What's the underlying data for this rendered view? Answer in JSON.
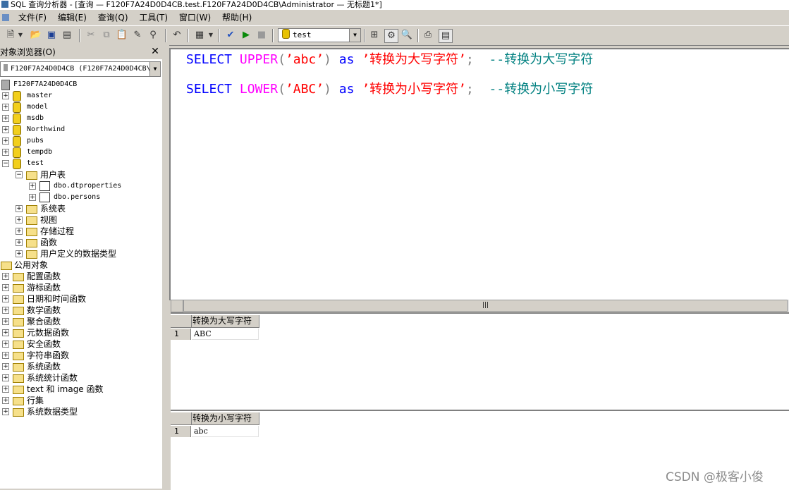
{
  "window": {
    "title": "SQL 查询分析器 - [查询 — F120F7A24D0D4CB.test.F120F7A24D0D4CB\\Administrator — 无标题1*]"
  },
  "menu": [
    "文件(F)",
    "编辑(E)",
    "查询(Q)",
    "工具(T)",
    "窗口(W)",
    "帮助(H)"
  ],
  "toolbar": {
    "icons": [
      "new-query-icon",
      "open-icon",
      "save-icon",
      "insert-template-icon",
      "cut-icon",
      "copy-icon",
      "paste-icon",
      "clear-icon",
      "find-icon",
      "undo-icon",
      "results-mode-icon",
      "parse-icon",
      "execute-icon",
      "cancel-icon",
      "object-browser-icon",
      "object-search-icon",
      "current-connection-icon",
      "results-pane-icon"
    ],
    "database": "test"
  },
  "object_browser": {
    "title": "对象浏览器(O)",
    "server_combo": "F120F7A24D0D4CB (F120F7A24D0D4CB\\",
    "root": "F120F7A24D0D4CB",
    "databases": [
      "master",
      "model",
      "msdb",
      "Northwind",
      "pubs",
      "tempdb",
      "test"
    ],
    "test_children": {
      "user_tables": "用户表",
      "tables": [
        "dbo.dtproperties",
        "dbo.persons"
      ],
      "others": [
        "系统表",
        "视图",
        "存储过程",
        "函数",
        "用户定义的数据类型"
      ]
    },
    "public_objects": "公用对象",
    "public_children": [
      "配置函数",
      "游标函数",
      "日期和时间函数",
      "数学函数",
      "聚合函数",
      "元数据函数",
      "安全函数",
      "字符串函数",
      "系统函数",
      "系统统计函数",
      "text 和 image 函数",
      "行集",
      "系统数据类型"
    ]
  },
  "editor": {
    "line1": {
      "kw1": "SELECT",
      "fn": "UPPER",
      "lp": "(",
      "arg": "’abc’",
      "rp": ")",
      "kw2": "as",
      "alias": "’转换为大写字符’",
      "semi": ";",
      "comment": "--转换为大写字符"
    },
    "line2": {
      "kw1": "SELECT",
      "fn": "LOWER",
      "lp": "(",
      "arg": "’ABC’",
      "rp": ")",
      "kw2": "as",
      "alias": "’转换为小写字符’",
      "semi": ";",
      "comment": "--转换为小写字符"
    }
  },
  "results": [
    {
      "column": "转换为大写字符",
      "row_number": "1",
      "value": "ABC"
    },
    {
      "column": "转换为小写字符",
      "row_number": "1",
      "value": "abc"
    }
  ],
  "watermark": "CSDN @极客小俊"
}
